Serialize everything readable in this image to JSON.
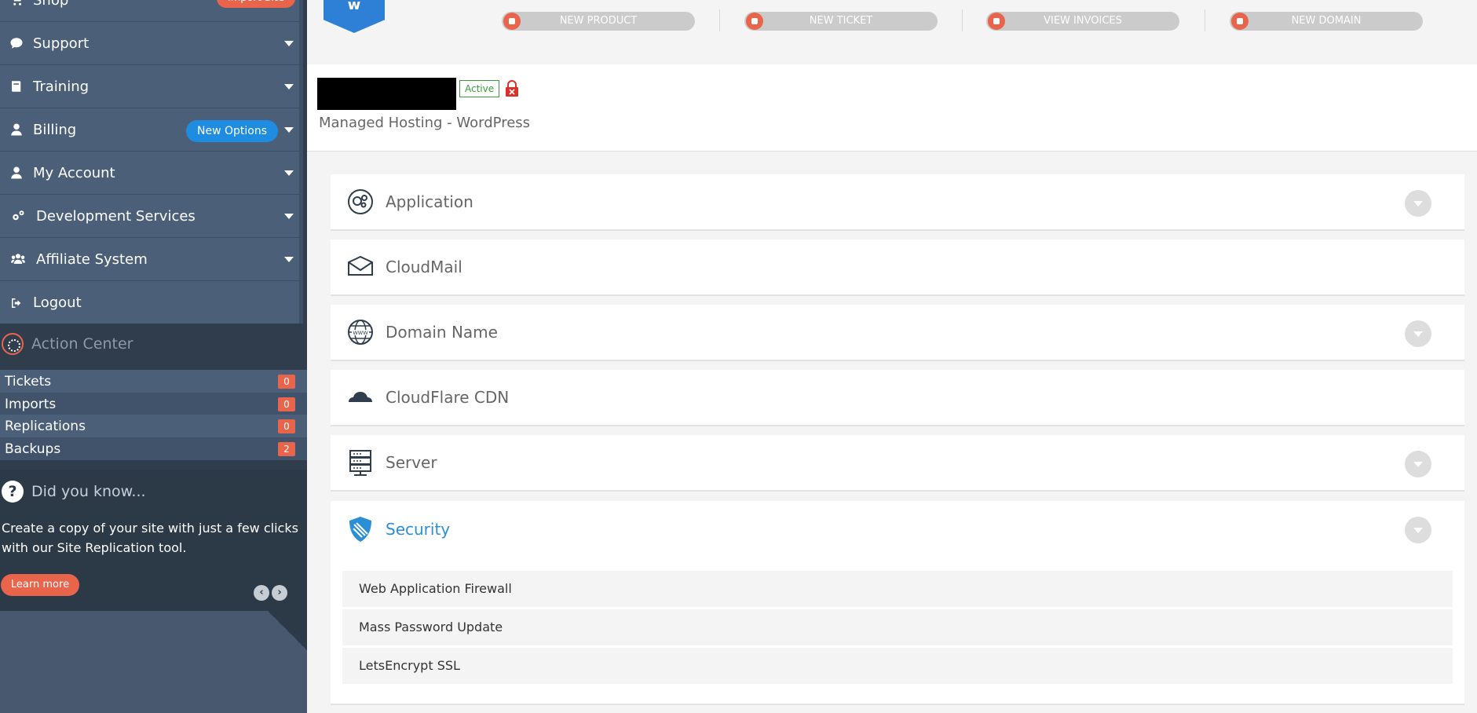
{
  "sidebar": {
    "nav": [
      {
        "label": "Shop",
        "icon": "cart-icon",
        "pill": "Import Site"
      },
      {
        "label": "Support",
        "icon": "chat-icon"
      },
      {
        "label": "Training",
        "icon": "book-icon"
      },
      {
        "label": "Billing",
        "icon": "user-icon",
        "pill": "New Options"
      },
      {
        "label": "My Account",
        "icon": "user-icon"
      },
      {
        "label": "Development Services",
        "icon": "gears-icon"
      },
      {
        "label": "Affiliate System",
        "icon": "users-icon"
      },
      {
        "label": "Logout",
        "icon": "logout-icon"
      }
    ],
    "action_center": {
      "title": "Action Center",
      "rows": [
        {
          "label": "Tickets",
          "count": "0"
        },
        {
          "label": "Imports",
          "count": "0"
        },
        {
          "label": "Replications",
          "count": "0"
        },
        {
          "label": "Backups",
          "count": "2"
        }
      ]
    },
    "did_you_know": {
      "title": "Did you know...",
      "text": "Create a copy of your site with just a few clicks with our Site Replication tool.",
      "button": "Learn more",
      "prev": "‹",
      "next": "›"
    }
  },
  "quick_actions": [
    {
      "label": "NEW PRODUCT",
      "icon": "cart-icon"
    },
    {
      "label": "NEW TICKET",
      "icon": "chat-icon"
    },
    {
      "label": "VIEW INVOICES",
      "icon": "invoice-icon"
    },
    {
      "label": "NEW DOMAIN",
      "icon": "globe-icon"
    }
  ],
  "service": {
    "status": "Active",
    "name": "Managed Hosting - WordPress"
  },
  "panels": [
    {
      "title": "Application",
      "icon": "gears-icon",
      "expandable": true
    },
    {
      "title": "CloudMail",
      "icon": "envelope-icon",
      "expandable": false
    },
    {
      "title": "Domain Name",
      "icon": "www-globe-icon",
      "expandable": true
    },
    {
      "title": "CloudFlare CDN",
      "icon": "cloud-icon",
      "expandable": false
    },
    {
      "title": "Server",
      "icon": "server-icon",
      "expandable": true
    },
    {
      "title": "Security",
      "icon": "shield-icon",
      "expandable": true,
      "active": true
    }
  ],
  "security_items": [
    "Web Application Firewall",
    "Mass Password Update",
    "LetsEncrypt SSL"
  ],
  "colors": {
    "sidebar": "#4b5f78",
    "accent": "#e8654c",
    "blue": "#2b8fd8",
    "logo": "#2e7fd6"
  }
}
